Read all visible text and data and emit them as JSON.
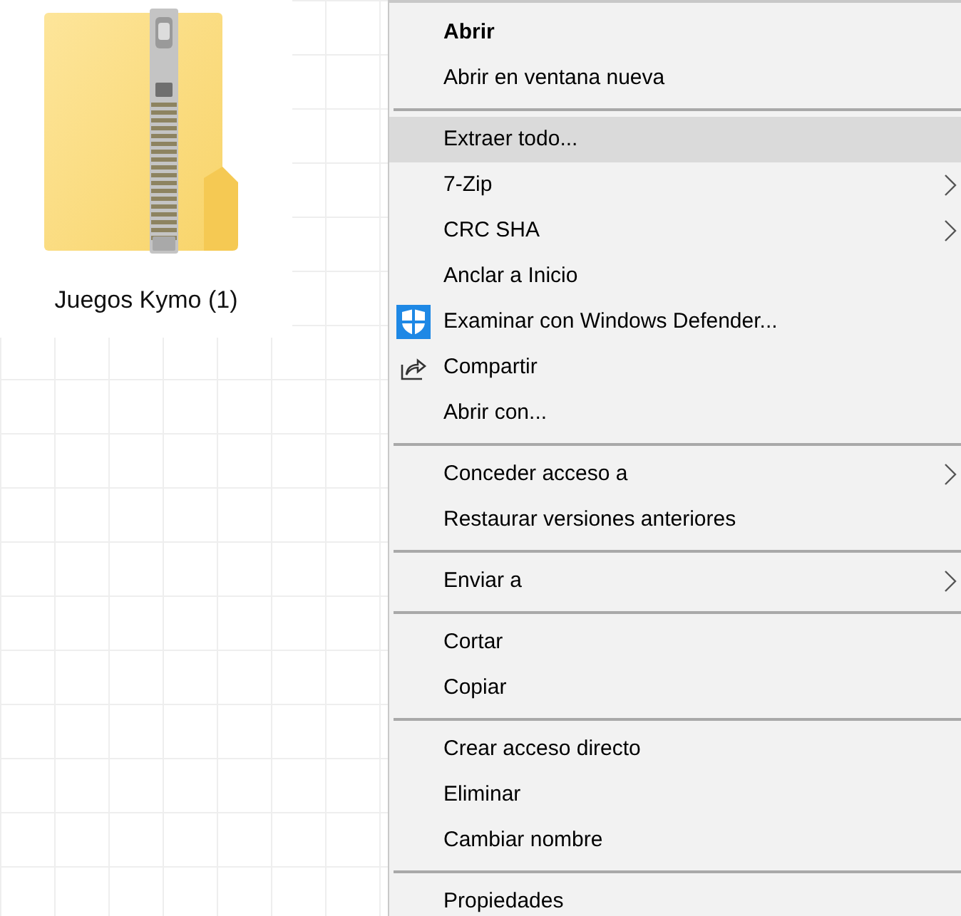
{
  "desktop_item": {
    "label": "Juegos Kymo (1)"
  },
  "context_menu": {
    "items": [
      {
        "kind": "item",
        "label": "Abrir",
        "default": true,
        "selected": false,
        "submenu": false
      },
      {
        "kind": "item",
        "label": "Abrir en ventana nueva",
        "default": false,
        "selected": false,
        "submenu": false
      },
      {
        "kind": "separator"
      },
      {
        "kind": "item",
        "label": "Extraer todo...",
        "default": false,
        "selected": true,
        "submenu": false
      },
      {
        "kind": "item",
        "label": "7-Zip",
        "default": false,
        "selected": false,
        "submenu": true
      },
      {
        "kind": "item",
        "label": "CRC SHA",
        "default": false,
        "selected": false,
        "submenu": true
      },
      {
        "kind": "item",
        "label": "Anclar a Inicio",
        "default": false,
        "selected": false,
        "submenu": false
      },
      {
        "kind": "shield",
        "label": "Examinar con Windows Defender...",
        "default": false,
        "selected": false,
        "submenu": false
      },
      {
        "kind": "share",
        "label": "Compartir",
        "default": false,
        "selected": false,
        "submenu": false
      },
      {
        "kind": "item",
        "label": "Abrir con...",
        "default": false,
        "selected": false,
        "submenu": false
      },
      {
        "kind": "separator"
      },
      {
        "kind": "item",
        "label": "Conceder acceso a",
        "default": false,
        "selected": false,
        "submenu": true
      },
      {
        "kind": "item",
        "label": "Restaurar versiones anteriores",
        "default": false,
        "selected": false,
        "submenu": false
      },
      {
        "kind": "separator"
      },
      {
        "kind": "item",
        "label": "Enviar a",
        "default": false,
        "selected": false,
        "submenu": true
      },
      {
        "kind": "separator"
      },
      {
        "kind": "item",
        "label": "Cortar",
        "default": false,
        "selected": false,
        "submenu": false
      },
      {
        "kind": "item",
        "label": "Copiar",
        "default": false,
        "selected": false,
        "submenu": false
      },
      {
        "kind": "separator"
      },
      {
        "kind": "item",
        "label": "Crear acceso directo",
        "default": false,
        "selected": false,
        "submenu": false
      },
      {
        "kind": "item",
        "label": "Eliminar",
        "default": false,
        "selected": false,
        "submenu": false
      },
      {
        "kind": "item",
        "label": "Cambiar nombre",
        "default": false,
        "selected": false,
        "submenu": false
      },
      {
        "kind": "separator"
      },
      {
        "kind": "item",
        "label": "Propiedades",
        "default": false,
        "selected": false,
        "submenu": false
      }
    ]
  }
}
